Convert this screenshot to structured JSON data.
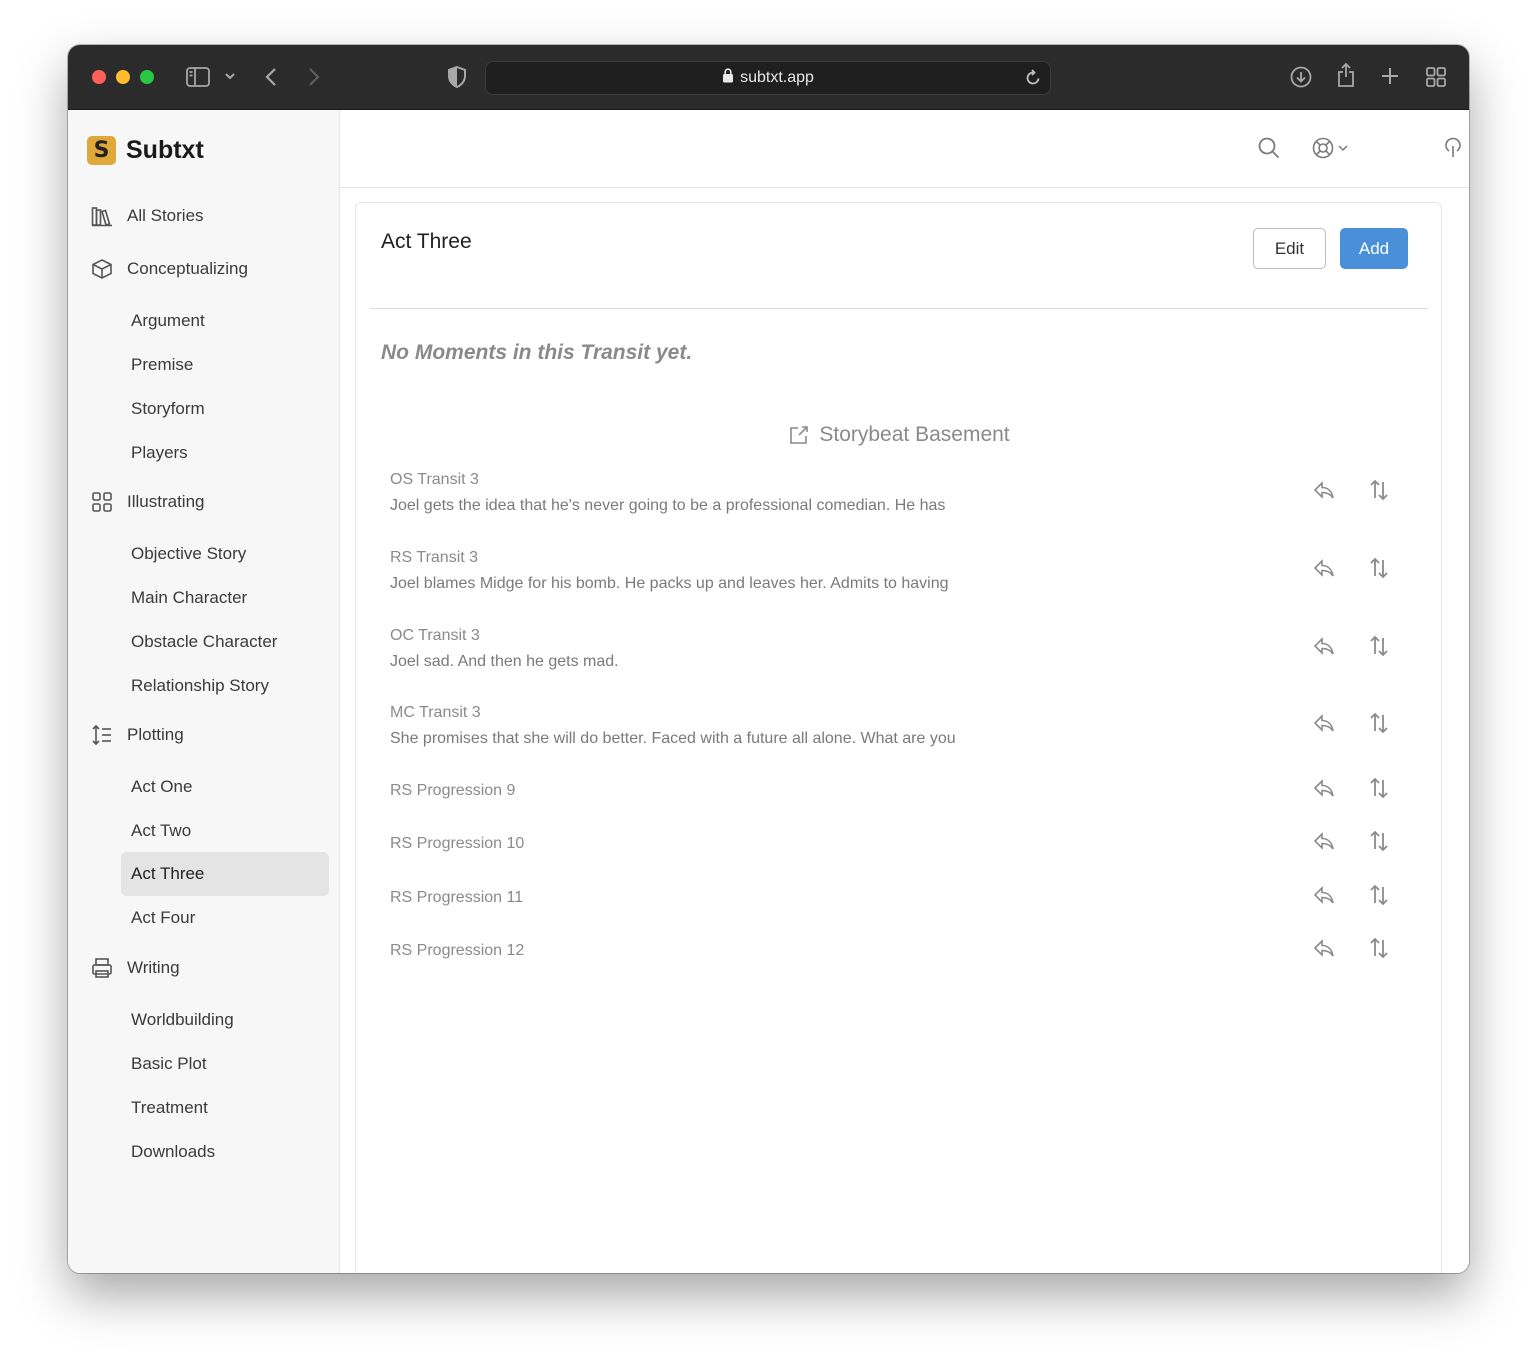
{
  "browser": {
    "url": "subtxt.app"
  },
  "sidebar": {
    "brand": "Subtxt",
    "brand_logo_letter": "S",
    "sections": {
      "all_stories": "All Stories",
      "conceptualizing": "Conceptualizing",
      "illustrating": "Illustrating",
      "plotting": "Plotting",
      "writing": "Writing"
    },
    "conceptualizing_items": [
      "Argument",
      "Premise",
      "Storyform",
      "Players"
    ],
    "illustrating_items": [
      "Objective Story",
      "Main Character",
      "Obstacle Character",
      "Relationship Story"
    ],
    "plotting_items": [
      "Act One",
      "Act Two",
      "Act Three",
      "Act Four"
    ],
    "writing_items": [
      "Worldbuilding",
      "Basic Plot",
      "Treatment",
      "Downloads"
    ],
    "active_item": "Act Three"
  },
  "main": {
    "title": "Act Three",
    "edit_label": "Edit",
    "add_label": "Add",
    "empty_message": "No Moments in this Transit yet.",
    "basement_title": "Storybeat Basement",
    "beats": [
      {
        "title": "OS Transit 3",
        "desc": "Joel gets the idea that he's never going to be a professional comedian. He has"
      },
      {
        "title": "RS Transit 3",
        "desc": "Joel blames Midge for his bomb. He packs up and leaves her. Admits to having"
      },
      {
        "title": "OC Transit 3",
        "desc": "Joel sad. And then he gets mad."
      },
      {
        "title": "MC Transit 3",
        "desc": "She promises that she will do better. Faced with a future all alone. What are you"
      },
      {
        "title": "RS Progression 9",
        "desc": ""
      },
      {
        "title": "RS Progression 10",
        "desc": ""
      },
      {
        "title": "RS Progression 11",
        "desc": ""
      },
      {
        "title": "RS Progression 12",
        "desc": ""
      }
    ]
  },
  "colors": {
    "accent": "#4a90d9",
    "brand": "#e0a838",
    "toolbar": "#2b2b2b"
  }
}
